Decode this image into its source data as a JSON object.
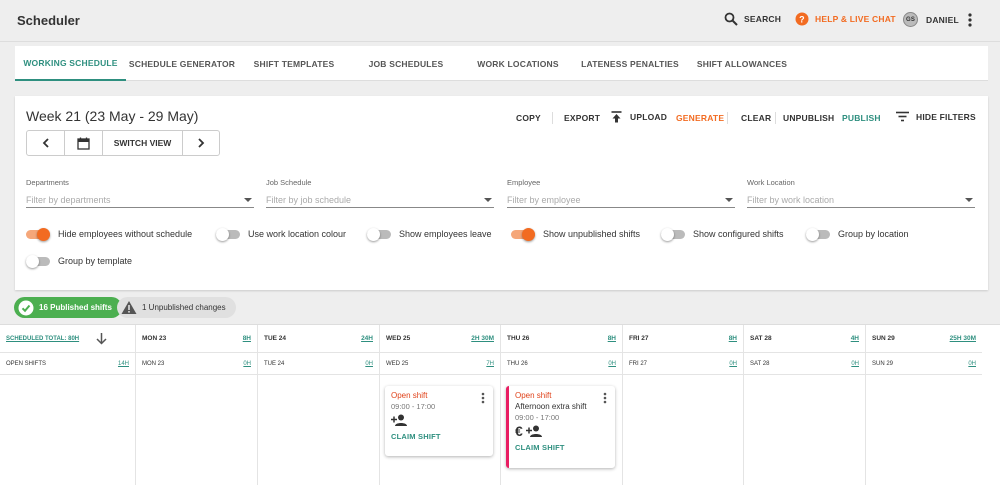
{
  "app": {
    "title": "Scheduler"
  },
  "topbar": {
    "search_label": "SEARCH",
    "help_label": "HELP & LIVE CHAT",
    "user_initials": "GS",
    "user_name": "DANIEL"
  },
  "tabs": [
    {
      "label": "WORKING SCHEDULE",
      "active": true
    },
    {
      "label": "SCHEDULE GENERATOR",
      "active": false
    },
    {
      "label": "SHIFT TEMPLATES",
      "active": false
    },
    {
      "label": "JOB SCHEDULES",
      "active": false
    },
    {
      "label": "WORK LOCATIONS",
      "active": false
    },
    {
      "label": "LATENESS PENALTIES",
      "active": false
    },
    {
      "label": "SHIFT ALLOWANCES",
      "active": false
    }
  ],
  "panel": {
    "week_title": "Week 21 (23 May - 29 May)",
    "switch_view_label": "SWITCH VIEW",
    "actions": {
      "copy": "COPY",
      "export": "EXPORT",
      "upload": "UPLOAD",
      "generate": "GENERATE",
      "clear": "CLEAR",
      "unpublish": "UNPUBLISH",
      "publish": "PUBLISH",
      "hide_filters": "HIDE FILTERS"
    },
    "filters": [
      {
        "label": "Departments",
        "placeholder": "Filter by departments"
      },
      {
        "label": "Job Schedule",
        "placeholder": "Filter by job schedule"
      },
      {
        "label": "Employee",
        "placeholder": "Filter by employee"
      },
      {
        "label": "Work Location",
        "placeholder": "Filter by work location"
      }
    ],
    "toggles": [
      {
        "label": "Hide employees without schedule",
        "on": true
      },
      {
        "label": "Use work location colour",
        "on": false
      },
      {
        "label": "Show employees leave",
        "on": false
      },
      {
        "label": "Show unpublished shifts",
        "on": true
      },
      {
        "label": "Show configured shifts",
        "on": false
      },
      {
        "label": "Group by location",
        "on": false
      },
      {
        "label": "Group by template",
        "on": false
      }
    ]
  },
  "badges": {
    "published": "16 Published shifts",
    "unpublished": "1 Unpublished changes"
  },
  "grid": {
    "first_col": {
      "title": "SCHEDULED TOTAL: 80H",
      "sub": "OPEN SHIFTS",
      "sub_hours": "14H"
    },
    "days": [
      {
        "day": "MON 23",
        "hours": "8H",
        "sub_hours": "0H"
      },
      {
        "day": "TUE 24",
        "hours": "24H",
        "sub_hours": "0H"
      },
      {
        "day": "WED 25",
        "hours": "2H 30M",
        "sub_hours": "7H"
      },
      {
        "day": "THU 26",
        "hours": "8H",
        "sub_hours": "0H"
      },
      {
        "day": "FRI 27",
        "hours": "8H",
        "sub_hours": "0H"
      },
      {
        "day": "SAT 28",
        "hours": "4H",
        "sub_hours": "0H"
      },
      {
        "day": "SUN 29",
        "hours": "25H 30M",
        "sub_hours": "0H"
      }
    ],
    "cards": [
      {
        "title": "Open shift",
        "time": "09:00 - 17:00",
        "claim": "CLAIM SHIFT"
      },
      {
        "title": "Open shift",
        "subtitle": "Afternoon extra shift",
        "time": "09:00 - 17:00",
        "claim": "CLAIM SHIFT"
      }
    ]
  },
  "colors": {
    "accent": "#2e8f7f",
    "orange": "#f26b21",
    "green": "#4caf50",
    "pink": "#e91e63"
  }
}
